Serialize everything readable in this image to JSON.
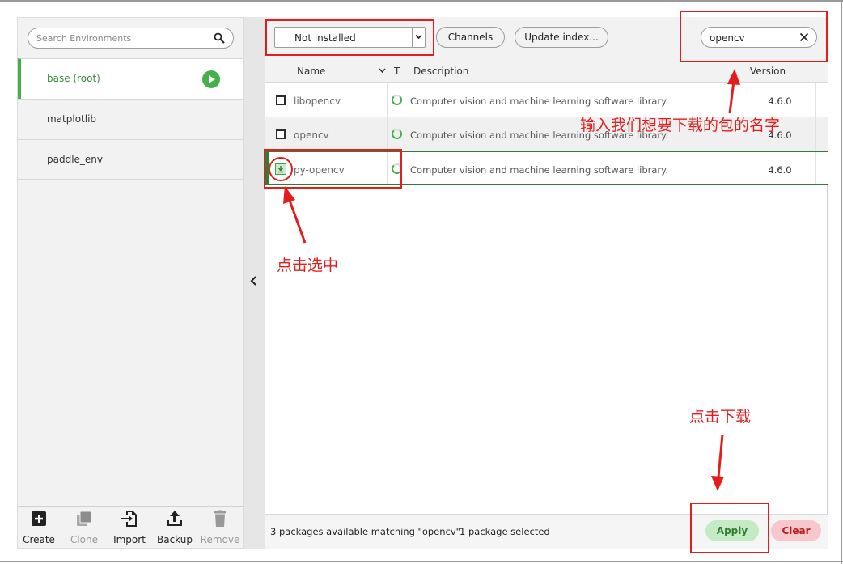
{
  "sidebar": {
    "search_placeholder": "Search Environments",
    "environments": [
      {
        "label": "base (root)",
        "active": true
      },
      {
        "label": "matplotlib",
        "active": false
      },
      {
        "label": "paddle_env",
        "active": false
      }
    ],
    "actions": {
      "create": "Create",
      "clone": "Clone",
      "import": "Import",
      "backup": "Backup",
      "remove": "Remove"
    }
  },
  "toolbar": {
    "filter_value": "Not installed",
    "channels_label": "Channels",
    "update_index_label": "Update index...",
    "search_value": "opencv"
  },
  "table": {
    "headers": {
      "name": "Name",
      "type": "T",
      "description": "Description",
      "version": "Version"
    },
    "rows": [
      {
        "name": "libopencv",
        "description": "Computer vision and machine learning software library.",
        "version": "4.6.0",
        "selected": false
      },
      {
        "name": "opencv",
        "description": "Computer vision and machine learning software library.",
        "version": "4.6.0",
        "selected": false
      },
      {
        "name": "py-opencv",
        "description": "Computer vision and machine learning software library.",
        "version": "4.6.0",
        "selected": true
      }
    ]
  },
  "status": {
    "matching_text": "3 packages available matching \"opencv\"",
    "selected_text": "1 package selected",
    "apply_label": "Apply",
    "clear_label": "Clear"
  },
  "annotations": {
    "search_note": "输入我们想要下载的包的名字",
    "select_note": "点击选中",
    "apply_note": "点击下载",
    "color": "#e51c1c"
  },
  "colors": {
    "accent_green": "#43b049",
    "selected_row_border": "#2e7d32",
    "apply_bg": "#c4eac6",
    "clear_bg": "#f7c7cb"
  }
}
